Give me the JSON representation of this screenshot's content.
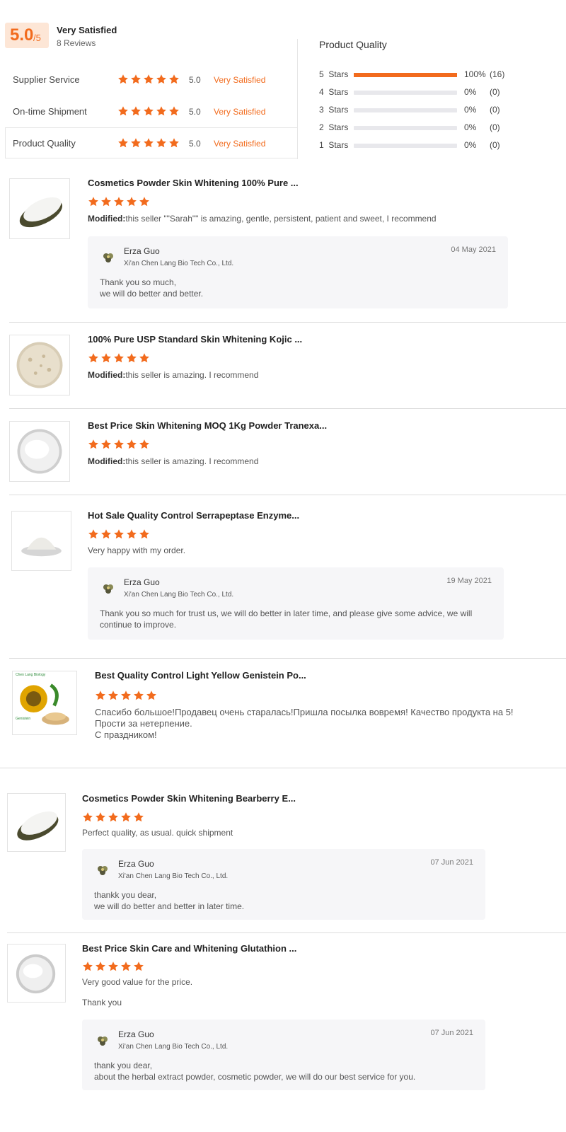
{
  "summary": {
    "score": "5.0",
    "score_max": "/5",
    "label": "Very Satisfied",
    "reviews_count": "8 Reviews",
    "rows": [
      {
        "label": "Supplier Service",
        "value": "5.0",
        "status": "Very Satisfied",
        "stars": 5
      },
      {
        "label": "On-time Shipment",
        "value": "5.0",
        "status": "Very Satisfied",
        "stars": 5
      },
      {
        "label": "Product Quality",
        "value": "5.0",
        "status": "Very Satisfied",
        "stars": 5
      }
    ]
  },
  "distribution": {
    "title": "Product Quality",
    "rows": [
      {
        "label": "5  Stars",
        "percent": "100%",
        "count": "(16)",
        "fill": 1.0
      },
      {
        "label": "4  Stars",
        "percent": "0%",
        "count": "(0)",
        "fill": 0
      },
      {
        "label": "3  Stars",
        "percent": "0%",
        "count": "(0)",
        "fill": 0
      },
      {
        "label": "2  Stars",
        "percent": "0%",
        "count": "(0)",
        "fill": 0
      },
      {
        "label": "1  Stars",
        "percent": "0%",
        "count": "(0)",
        "fill": 0
      }
    ]
  },
  "colors": {
    "accent": "#f26b1d",
    "reply_bg": "#f6f6f8"
  },
  "reviews": [
    {
      "title": "Cosmetics Powder Skin Whitening 100% Pure ...",
      "stars": 5,
      "modified_label": "Modified:",
      "text": "this seller \"\"Sarah\"\" is amazing, gentle, persistent, patient and sweet, I recommend",
      "reply": {
        "name": "Erza Guo",
        "company": "Xi'an Chen Lang Bio Tech Co., Ltd.",
        "date": "04 May 2021",
        "text": "Thank you so much,\nwe will do better and better."
      }
    },
    {
      "title": "100% Pure USP Standard Skin Whitening Kojic ...",
      "stars": 5,
      "modified_label": "Modified:",
      "text": "this seller is amazing. I recommend"
    },
    {
      "title": "Best Price Skin Whitening MOQ 1Kg Powder Tranexa...",
      "stars": 5,
      "modified_label": "Modified:",
      "text": "this seller is amazing. I recommend"
    },
    {
      "title": "Hot Sale Quality Control Serrapeptase Enzyme...",
      "stars": 5,
      "text": "Very happy with my order.",
      "reply": {
        "name": "Erza Guo",
        "company": "Xi'an Chen Lang Bio Tech Co., Ltd.",
        "date": "19 May 2021",
        "text": "Thank you so much for trust us, we will do better in later time, and please give some advice, we will\ncontinue to improve."
      }
    },
    {
      "title": "Best Quality Control Light Yellow Genistein Po...",
      "stars": 5,
      "text": "Спасибо большое!Продавец очень старалась!Пришла посылка вовремя! Качество продукта на 5!\nПрости за нетерпение.\nС праздником!",
      "thumb_caption_top": "Chen Lang Biology",
      "thumb_caption_bottom": "Genistein"
    },
    {
      "title": "Cosmetics Powder Skin Whitening Bearberry E...",
      "stars": 5,
      "text": "Perfect quality,  as usual. quick shipment",
      "reply": {
        "name": "Erza Guo",
        "company": "Xi'an Chen Lang Bio Tech Co., Ltd.",
        "date": "07 Jun 2021",
        "text": "thankk you dear,\nwe will do better and better in later time."
      }
    },
    {
      "title": "Best Price Skin Care and Whitening Glutathion ...",
      "stars": 5,
      "text": "Very good value for the price.",
      "text2": "Thank you",
      "reply": {
        "name": "Erza Guo",
        "company": "Xi'an Chen Lang Bio Tech Co., Ltd.",
        "date": "07 Jun 2021",
        "text": "thank you dear,\nabout the herbal extract powder, cosmetic powder, we will do our best service for you."
      }
    }
  ]
}
